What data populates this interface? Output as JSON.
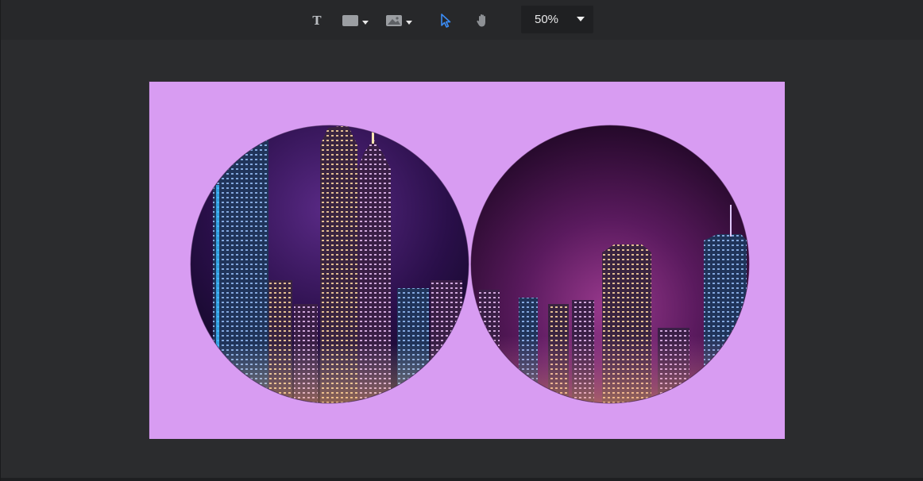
{
  "toolbar": {
    "tools": [
      {
        "name": "text-tool",
        "glyph": "T"
      },
      {
        "name": "rectangle-tool",
        "icon": "rectangle-icon"
      },
      {
        "name": "image-tool",
        "icon": "image-icon"
      },
      {
        "name": "select-tool",
        "icon": "pointer-icon",
        "active": true
      },
      {
        "name": "hand-tool",
        "icon": "hand-icon"
      }
    ],
    "zoom": "50%"
  },
  "colors": {
    "app_background": "#2a2b2d",
    "toolbar_background": "#27282a",
    "zoom_background": "#1f2022",
    "artboard_fill": "#d89cf2",
    "active_tool": "#3b8cf5",
    "icon_gray": "#b9bcc0"
  },
  "canvas": {
    "photos": [
      {
        "name": "city-skyline-left",
        "icon": "photo-icon"
      },
      {
        "name": "city-skyline-right",
        "icon": "photo-icon"
      }
    ]
  }
}
